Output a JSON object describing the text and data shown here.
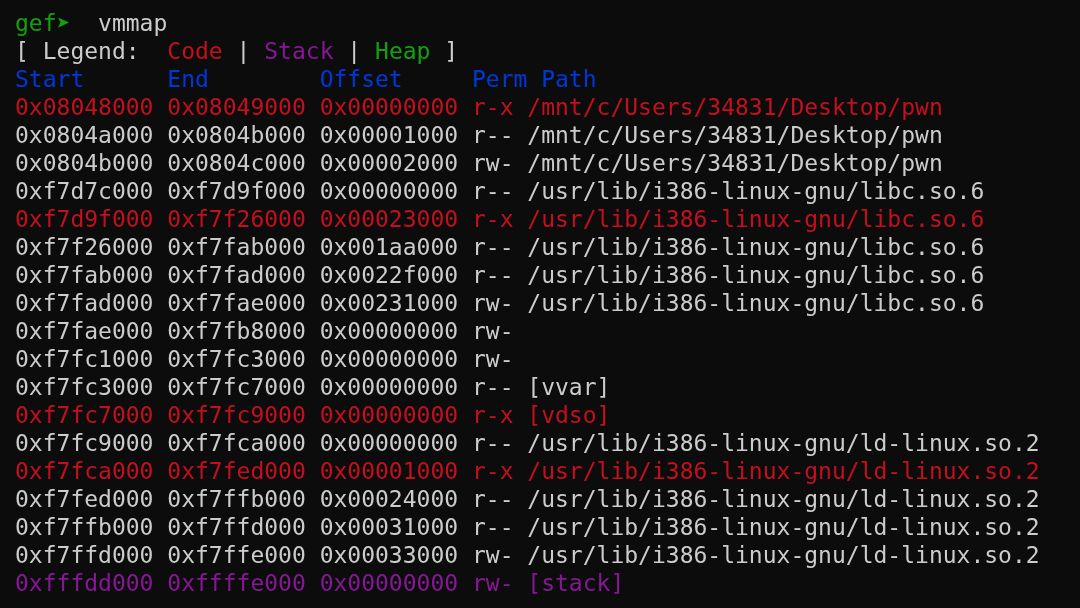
{
  "prompt": {
    "label": "gef➤",
    "command": "vmmap"
  },
  "legend": [
    {
      "text": "[ Legend:",
      "kind": "plain"
    },
    {
      "text": "Code",
      "kind": "code"
    },
    {
      "text": "|",
      "kind": "plain"
    },
    {
      "text": "Stack",
      "kind": "stack"
    },
    {
      "text": "|",
      "kind": "plain"
    },
    {
      "text": "Heap",
      "kind": "heap"
    },
    {
      "text": "]",
      "kind": "plain"
    }
  ],
  "columns": [
    "Start",
    "End",
    "Offset",
    "Perm",
    "Path"
  ],
  "rows": [
    {
      "kind": "code",
      "start": "0x08048000",
      "end": "0x08049000",
      "offset": "0x00000000",
      "perm": "r-x",
      "path": "/mnt/c/Users/34831/Desktop/pwn"
    },
    {
      "kind": "plain",
      "start": "0x0804a000",
      "end": "0x0804b000",
      "offset": "0x00001000",
      "perm": "r--",
      "path": "/mnt/c/Users/34831/Desktop/pwn"
    },
    {
      "kind": "plain",
      "start": "0x0804b000",
      "end": "0x0804c000",
      "offset": "0x00002000",
      "perm": "rw-",
      "path": "/mnt/c/Users/34831/Desktop/pwn"
    },
    {
      "kind": "plain",
      "start": "0xf7d7c000",
      "end": "0xf7d9f000",
      "offset": "0x00000000",
      "perm": "r--",
      "path": "/usr/lib/i386-linux-gnu/libc.so.6"
    },
    {
      "kind": "code",
      "start": "0xf7d9f000",
      "end": "0xf7f26000",
      "offset": "0x00023000",
      "perm": "r-x",
      "path": "/usr/lib/i386-linux-gnu/libc.so.6"
    },
    {
      "kind": "plain",
      "start": "0xf7f26000",
      "end": "0xf7fab000",
      "offset": "0x001aa000",
      "perm": "r--",
      "path": "/usr/lib/i386-linux-gnu/libc.so.6"
    },
    {
      "kind": "plain",
      "start": "0xf7fab000",
      "end": "0xf7fad000",
      "offset": "0x0022f000",
      "perm": "r--",
      "path": "/usr/lib/i386-linux-gnu/libc.so.6"
    },
    {
      "kind": "plain",
      "start": "0xf7fad000",
      "end": "0xf7fae000",
      "offset": "0x00231000",
      "perm": "rw-",
      "path": "/usr/lib/i386-linux-gnu/libc.so.6"
    },
    {
      "kind": "plain",
      "start": "0xf7fae000",
      "end": "0xf7fb8000",
      "offset": "0x00000000",
      "perm": "rw-"
    },
    {
      "kind": "plain",
      "start": "0xf7fc1000",
      "end": "0xf7fc3000",
      "offset": "0x00000000",
      "perm": "rw-"
    },
    {
      "kind": "plain",
      "start": "0xf7fc3000",
      "end": "0xf7fc7000",
      "offset": "0x00000000",
      "perm": "r--",
      "path": "[vvar]"
    },
    {
      "kind": "code",
      "start": "0xf7fc7000",
      "end": "0xf7fc9000",
      "offset": "0x00000000",
      "perm": "r-x",
      "path": "[vdso]"
    },
    {
      "kind": "plain",
      "start": "0xf7fc9000",
      "end": "0xf7fca000",
      "offset": "0x00000000",
      "perm": "r--",
      "path": "/usr/lib/i386-linux-gnu/ld-linux.so.2"
    },
    {
      "kind": "code",
      "start": "0xf7fca000",
      "end": "0xf7fed000",
      "offset": "0x00001000",
      "perm": "r-x",
      "path": "/usr/lib/i386-linux-gnu/ld-linux.so.2"
    },
    {
      "kind": "plain",
      "start": "0xf7fed000",
      "end": "0xf7ffb000",
      "offset": "0x00024000",
      "perm": "r--",
      "path": "/usr/lib/i386-linux-gnu/ld-linux.so.2"
    },
    {
      "kind": "plain",
      "start": "0xf7ffb000",
      "end": "0xf7ffd000",
      "offset": "0x00031000",
      "perm": "r--",
      "path": "/usr/lib/i386-linux-gnu/ld-linux.so.2"
    },
    {
      "kind": "plain",
      "start": "0xf7ffd000",
      "end": "0xf7ffe000",
      "offset": "0x00033000",
      "perm": "rw-",
      "path": "/usr/lib/i386-linux-gnu/ld-linux.so.2"
    },
    {
      "kind": "stack",
      "start": "0xfffdd000",
      "end": "0xffffe000",
      "offset": "0x00000000",
      "perm": "rw-",
      "path": "[stack]"
    }
  ]
}
